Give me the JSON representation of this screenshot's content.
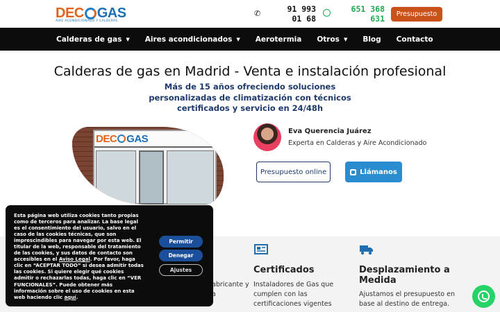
{
  "header": {
    "logo_dec": "DEC",
    "logo_gas": "GAS",
    "logo_tagline": "Aire acondicionado y calderas",
    "phone_primary": "91 993 01 68",
    "phone_whatsapp": "651 368 631",
    "cta_label": "Presupuesto"
  },
  "nav": {
    "items": [
      {
        "label": "Calderas de gas",
        "dropdown": true
      },
      {
        "label": "Aires acondicionados",
        "dropdown": true
      },
      {
        "label": "Aerotermia",
        "dropdown": false
      },
      {
        "label": "Otros",
        "dropdown": true
      },
      {
        "label": "Blog",
        "dropdown": false
      },
      {
        "label": "Contacto",
        "dropdown": false
      }
    ]
  },
  "hero": {
    "title": "Calderas de gas en Madrid - Venta e instalación profesional",
    "subtitle": "Más de 15 años ofreciendo soluciones personalizadas de climatización con técnicos certificados y servicio en 24/48h",
    "shop_sign_dec": "DEC",
    "shop_sign_gas": "GAS"
  },
  "author": {
    "name": "Eva Querencia Juárez",
    "role": "Experta en Calderas y Aire Acondicionado"
  },
  "cta": {
    "online_label": "Presupuesto online",
    "call_label": "Llámanos"
  },
  "features": [
    {
      "icon": "certificate-icon",
      "title": "Certificados",
      "text": "Instaladores de Gas que cumplen con las certificaciones vigentes"
    },
    {
      "icon": "truck-icon",
      "title": "Desplazamiento a Medida",
      "text": "Ajustamos el presupuesto en base al destino de entrega."
    }
  ],
  "features_partial_text": "abricante y",
  "features_partial_text2": "a",
  "cookie": {
    "text_before": "Esta página web utiliza cookies tanto propias como de terceros para analizar. La base legal es el consentimiento del usuario, salvo en el caso de las cookies técnicas, que son imprescindibles para navegar por esta web. El titular de la web, responsable del tratamiento de las cookies, y sus datos de contacto son accesibles en el",
    "link1": "Aviso Legal",
    "text_middle": ". Por favor, haga clic en “ACEPTAR TODO” si desea admitir todas las cookies. Si quiere elegir qué cookies admitir o rechazarlas todas, haga clic en “VER FUNCIONALES”. Puede obtener más información sobre el uso de cookies en esta web haciendo clic",
    "link2": "aquí",
    "text_end": ".",
    "accept_label": "Permitir",
    "deny_label": "Denegar",
    "adjust_label": "Ajustes"
  },
  "colors": {
    "brand_orange": "#c9521a",
    "brand_blue": "#1d3a6b",
    "call_blue": "#2a8dd0",
    "whatsapp_green": "#1ea952"
  }
}
